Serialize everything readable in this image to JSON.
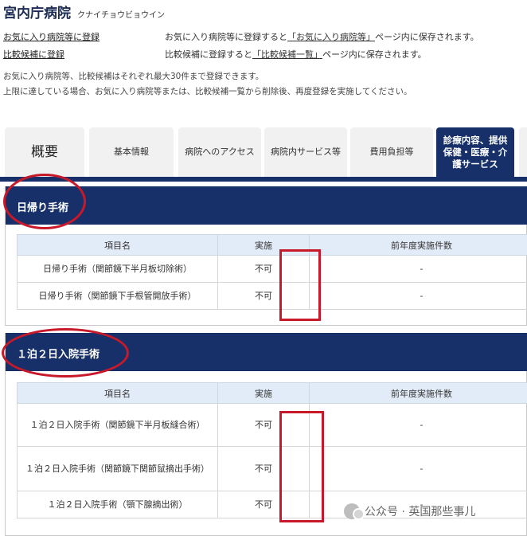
{
  "hospital": {
    "name": "宮内庁病院",
    "kana": "クナイチョウビョウイン"
  },
  "actions": [
    {
      "link": "お気に入り病院等に登録",
      "desc_prefix": "お気に入り病院等に登録すると",
      "desc_link": "「お気に入り病院等」",
      "desc_suffix": "ページ内に保存されます。"
    },
    {
      "link": "比較候補に登録",
      "desc_prefix": "比較候補に登録すると",
      "desc_link": "「比較候補一覧」",
      "desc_suffix": "ページ内に保存されます。"
    }
  ],
  "notice": {
    "line1": "お気に入り病院等、比較候補はそれぞれ最大30件まで登録できます。",
    "line2": "上限に達している場合、お気に入り病院等または、比較候補一覧から削除後、再度登録を実施してください。"
  },
  "tabs": [
    {
      "label": "概要"
    },
    {
      "label": "基本情報"
    },
    {
      "label": "病院へのアクセス"
    },
    {
      "label": "病院内サービス等"
    },
    {
      "label": "費用負担等"
    },
    {
      "label": "診療内容、提供保健・医療・介護サービス",
      "active": true
    }
  ],
  "sections": [
    {
      "title": "日帰り手術",
      "headers": [
        "項目名",
        "実施",
        "前年度実施件数"
      ],
      "rows": [
        {
          "name": "日帰り手術（関節鏡下半月板切除術）",
          "status": "不可",
          "count": "-"
        },
        {
          "name": "日帰り手術（関節鏡下手根管開放手術）",
          "status": "不可",
          "count": "-"
        }
      ]
    },
    {
      "title": "１泊２日入院手術",
      "headers": [
        "項目名",
        "実施",
        "前年度実施件数"
      ],
      "rows": [
        {
          "name": "１泊２日入院手術（関節鏡下半月板縫合術）",
          "status": "不可",
          "count": "-"
        },
        {
          "name": "１泊２日入院手術（関節鏡下関節鼠摘出手術）",
          "status": "不可",
          "count": "-"
        },
        {
          "name": "１泊２日入院手術（顎下腺摘出術）",
          "status": "不可",
          "count": "-"
        }
      ]
    }
  ],
  "watermark": "公众号 · 英国那些事儿",
  "colors": {
    "navy": "#17306a",
    "header_bg": "#e2ecf8",
    "tab_bg": "#f1f1f1",
    "highlight": "#c8192b"
  }
}
